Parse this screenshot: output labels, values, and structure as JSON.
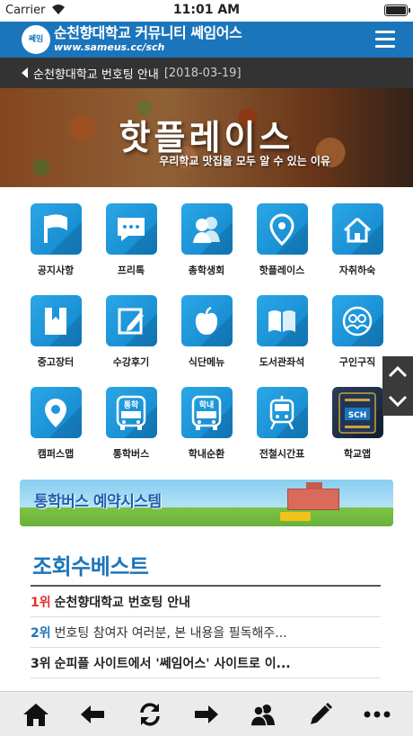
{
  "status_bar": {
    "carrier": "Carrier",
    "time": "11:01 AM"
  },
  "header": {
    "logo_text": "쎄임",
    "brand_name": "순천향대학교 커뮤니티 쎄임어스",
    "brand_url": "www.sameus.cc/sch"
  },
  "notice": {
    "text": "순천향대학교 번호팅 안내",
    "date": "[2018-03-19]"
  },
  "banner": {
    "title": "핫플레이스",
    "subtitle": "우리학교 맛집을 모두 알 수 있는 이유"
  },
  "grid": [
    {
      "label": "공지사항",
      "icon": "flag-icon"
    },
    {
      "label": "프리톡",
      "icon": "chat-bubble-icon"
    },
    {
      "label": "총학생회",
      "icon": "people-icon"
    },
    {
      "label": "핫플레이스",
      "icon": "location-pin-icon"
    },
    {
      "label": "자취하숙",
      "icon": "house-icon"
    },
    {
      "label": "중고장터",
      "icon": "bookmark-icon"
    },
    {
      "label": "수강후기",
      "icon": "pencil-note-icon"
    },
    {
      "label": "식단메뉴",
      "icon": "apple-icon"
    },
    {
      "label": "도서관좌석",
      "icon": "open-book-icon"
    },
    {
      "label": "구인구직",
      "icon": "group-circle-icon"
    },
    {
      "label": "캠퍼스맵",
      "icon": "map-pin-icon",
      "glyph_text": ""
    },
    {
      "label": "통학버스",
      "icon": "commute-bus-icon",
      "glyph_text": "통학"
    },
    {
      "label": "학내순환",
      "icon": "campus-bus-icon",
      "glyph_text": "학내"
    },
    {
      "label": "전철시간표",
      "icon": "train-icon"
    },
    {
      "label": "학교앱",
      "icon": "school-app-icon",
      "glyph_text": "SCH"
    }
  ],
  "bus_banner": {
    "text": "통학버스 예약시스템"
  },
  "best": {
    "title": "조회수베스트",
    "items": [
      {
        "rank": "1위",
        "text": "순천향대학교 번호팅 안내"
      },
      {
        "rank": "2위",
        "text": "번호팅 참여자 여러분, 본 내용을 필독해주..."
      },
      {
        "rank": "3위",
        "text": "순피플 사이트에서 '쎄임어스' 사이트로 이..."
      }
    ]
  },
  "colors": {
    "brand_blue": "#1b75bb",
    "tile_blue": "#1e95dd",
    "rank_red": "#e0302b",
    "notice_bg": "#333333"
  },
  "toolbar": [
    "home-icon",
    "back-arrow-icon",
    "refresh-icon",
    "forward-arrow-icon",
    "users-icon",
    "edit-pencil-icon",
    "more-icon"
  ]
}
